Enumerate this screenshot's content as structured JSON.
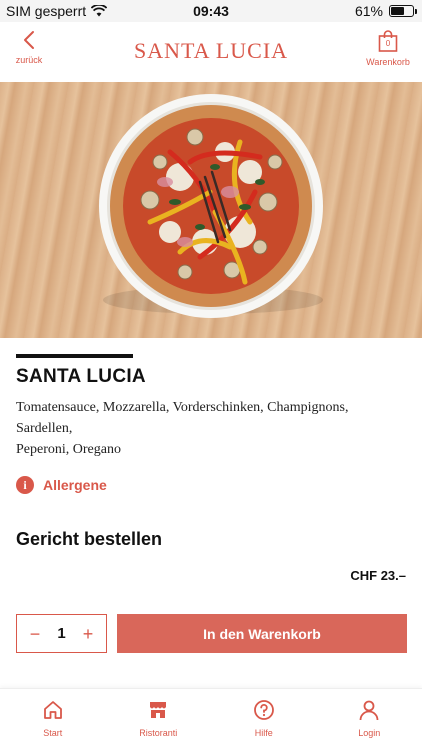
{
  "status_bar": {
    "carrier": "SIM gesperrt",
    "time": "09:43",
    "battery_text": "61%",
    "battery_level": 0.61
  },
  "header": {
    "back_label": "zurück",
    "brand": "SANTA LUCIA",
    "cart_label": "Warenkorb",
    "cart_count": "0"
  },
  "hero": {
    "image_alt_icon": "pizza-image"
  },
  "dish": {
    "title": "SANTA LUCIA",
    "ingredients_line1": "Tomatensauce, Mozzarella, Vorderschinken, Champignons,",
    "ingredients_line2": "Sardellen,",
    "ingredients_line3": "Peperoni, Oregano",
    "allergene_label": "Allergene"
  },
  "order": {
    "title": "Gericht bestellen",
    "price": "CHF 23.–",
    "minus": "−",
    "quantity": "1",
    "plus": "+",
    "add_to_cart": "In den Warenkorb"
  },
  "tabbar": {
    "items": [
      {
        "label": "Start",
        "icon": "home-icon"
      },
      {
        "label": "Ristoranti",
        "icon": "store-icon"
      },
      {
        "label": "Hilfe",
        "icon": "help-icon"
      },
      {
        "label": "Login",
        "icon": "user-icon"
      }
    ]
  },
  "colors": {
    "accent": "#d9584a",
    "button": "#d9675a"
  }
}
